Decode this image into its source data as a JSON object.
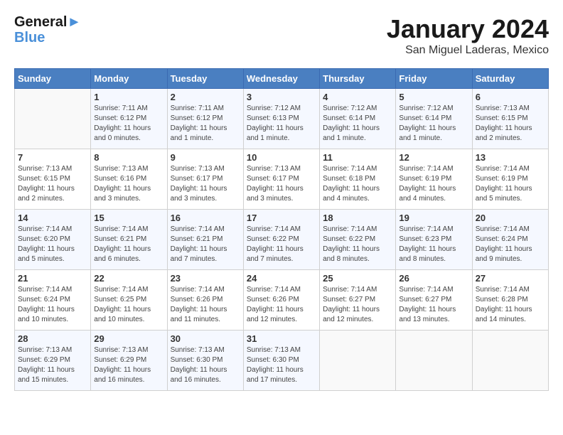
{
  "header": {
    "logo_line1": "General",
    "logo_line2": "Blue",
    "month_title": "January 2024",
    "location": "San Miguel Laderas, Mexico"
  },
  "weekdays": [
    "Sunday",
    "Monday",
    "Tuesday",
    "Wednesday",
    "Thursday",
    "Friday",
    "Saturday"
  ],
  "weeks": [
    [
      {
        "day": "",
        "sunrise": "",
        "sunset": "",
        "daylight": ""
      },
      {
        "day": "1",
        "sunrise": "Sunrise: 7:11 AM",
        "sunset": "Sunset: 6:12 PM",
        "daylight": "Daylight: 11 hours and 0 minutes."
      },
      {
        "day": "2",
        "sunrise": "Sunrise: 7:11 AM",
        "sunset": "Sunset: 6:12 PM",
        "daylight": "Daylight: 11 hours and 1 minute."
      },
      {
        "day": "3",
        "sunrise": "Sunrise: 7:12 AM",
        "sunset": "Sunset: 6:13 PM",
        "daylight": "Daylight: 11 hours and 1 minute."
      },
      {
        "day": "4",
        "sunrise": "Sunrise: 7:12 AM",
        "sunset": "Sunset: 6:14 PM",
        "daylight": "Daylight: 11 hours and 1 minute."
      },
      {
        "day": "5",
        "sunrise": "Sunrise: 7:12 AM",
        "sunset": "Sunset: 6:14 PM",
        "daylight": "Daylight: 11 hours and 1 minute."
      },
      {
        "day": "6",
        "sunrise": "Sunrise: 7:13 AM",
        "sunset": "Sunset: 6:15 PM",
        "daylight": "Daylight: 11 hours and 2 minutes."
      }
    ],
    [
      {
        "day": "7",
        "sunrise": "Sunrise: 7:13 AM",
        "sunset": "Sunset: 6:15 PM",
        "daylight": "Daylight: 11 hours and 2 minutes."
      },
      {
        "day": "8",
        "sunrise": "Sunrise: 7:13 AM",
        "sunset": "Sunset: 6:16 PM",
        "daylight": "Daylight: 11 hours and 3 minutes."
      },
      {
        "day": "9",
        "sunrise": "Sunrise: 7:13 AM",
        "sunset": "Sunset: 6:17 PM",
        "daylight": "Daylight: 11 hours and 3 minutes."
      },
      {
        "day": "10",
        "sunrise": "Sunrise: 7:13 AM",
        "sunset": "Sunset: 6:17 PM",
        "daylight": "Daylight: 11 hours and 3 minutes."
      },
      {
        "day": "11",
        "sunrise": "Sunrise: 7:14 AM",
        "sunset": "Sunset: 6:18 PM",
        "daylight": "Daylight: 11 hours and 4 minutes."
      },
      {
        "day": "12",
        "sunrise": "Sunrise: 7:14 AM",
        "sunset": "Sunset: 6:19 PM",
        "daylight": "Daylight: 11 hours and 4 minutes."
      },
      {
        "day": "13",
        "sunrise": "Sunrise: 7:14 AM",
        "sunset": "Sunset: 6:19 PM",
        "daylight": "Daylight: 11 hours and 5 minutes."
      }
    ],
    [
      {
        "day": "14",
        "sunrise": "Sunrise: 7:14 AM",
        "sunset": "Sunset: 6:20 PM",
        "daylight": "Daylight: 11 hours and 5 minutes."
      },
      {
        "day": "15",
        "sunrise": "Sunrise: 7:14 AM",
        "sunset": "Sunset: 6:21 PM",
        "daylight": "Daylight: 11 hours and 6 minutes."
      },
      {
        "day": "16",
        "sunrise": "Sunrise: 7:14 AM",
        "sunset": "Sunset: 6:21 PM",
        "daylight": "Daylight: 11 hours and 7 minutes."
      },
      {
        "day": "17",
        "sunrise": "Sunrise: 7:14 AM",
        "sunset": "Sunset: 6:22 PM",
        "daylight": "Daylight: 11 hours and 7 minutes."
      },
      {
        "day": "18",
        "sunrise": "Sunrise: 7:14 AM",
        "sunset": "Sunset: 6:22 PM",
        "daylight": "Daylight: 11 hours and 8 minutes."
      },
      {
        "day": "19",
        "sunrise": "Sunrise: 7:14 AM",
        "sunset": "Sunset: 6:23 PM",
        "daylight": "Daylight: 11 hours and 8 minutes."
      },
      {
        "day": "20",
        "sunrise": "Sunrise: 7:14 AM",
        "sunset": "Sunset: 6:24 PM",
        "daylight": "Daylight: 11 hours and 9 minutes."
      }
    ],
    [
      {
        "day": "21",
        "sunrise": "Sunrise: 7:14 AM",
        "sunset": "Sunset: 6:24 PM",
        "daylight": "Daylight: 11 hours and 10 minutes."
      },
      {
        "day": "22",
        "sunrise": "Sunrise: 7:14 AM",
        "sunset": "Sunset: 6:25 PM",
        "daylight": "Daylight: 11 hours and 10 minutes."
      },
      {
        "day": "23",
        "sunrise": "Sunrise: 7:14 AM",
        "sunset": "Sunset: 6:26 PM",
        "daylight": "Daylight: 11 hours and 11 minutes."
      },
      {
        "day": "24",
        "sunrise": "Sunrise: 7:14 AM",
        "sunset": "Sunset: 6:26 PM",
        "daylight": "Daylight: 11 hours and 12 minutes."
      },
      {
        "day": "25",
        "sunrise": "Sunrise: 7:14 AM",
        "sunset": "Sunset: 6:27 PM",
        "daylight": "Daylight: 11 hours and 12 minutes."
      },
      {
        "day": "26",
        "sunrise": "Sunrise: 7:14 AM",
        "sunset": "Sunset: 6:27 PM",
        "daylight": "Daylight: 11 hours and 13 minutes."
      },
      {
        "day": "27",
        "sunrise": "Sunrise: 7:14 AM",
        "sunset": "Sunset: 6:28 PM",
        "daylight": "Daylight: 11 hours and 14 minutes."
      }
    ],
    [
      {
        "day": "28",
        "sunrise": "Sunrise: 7:13 AM",
        "sunset": "Sunset: 6:29 PM",
        "daylight": "Daylight: 11 hours and 15 minutes."
      },
      {
        "day": "29",
        "sunrise": "Sunrise: 7:13 AM",
        "sunset": "Sunset: 6:29 PM",
        "daylight": "Daylight: 11 hours and 16 minutes."
      },
      {
        "day": "30",
        "sunrise": "Sunrise: 7:13 AM",
        "sunset": "Sunset: 6:30 PM",
        "daylight": "Daylight: 11 hours and 16 minutes."
      },
      {
        "day": "31",
        "sunrise": "Sunrise: 7:13 AM",
        "sunset": "Sunset: 6:30 PM",
        "daylight": "Daylight: 11 hours and 17 minutes."
      },
      {
        "day": "",
        "sunrise": "",
        "sunset": "",
        "daylight": ""
      },
      {
        "day": "",
        "sunrise": "",
        "sunset": "",
        "daylight": ""
      },
      {
        "day": "",
        "sunrise": "",
        "sunset": "",
        "daylight": ""
      }
    ]
  ]
}
